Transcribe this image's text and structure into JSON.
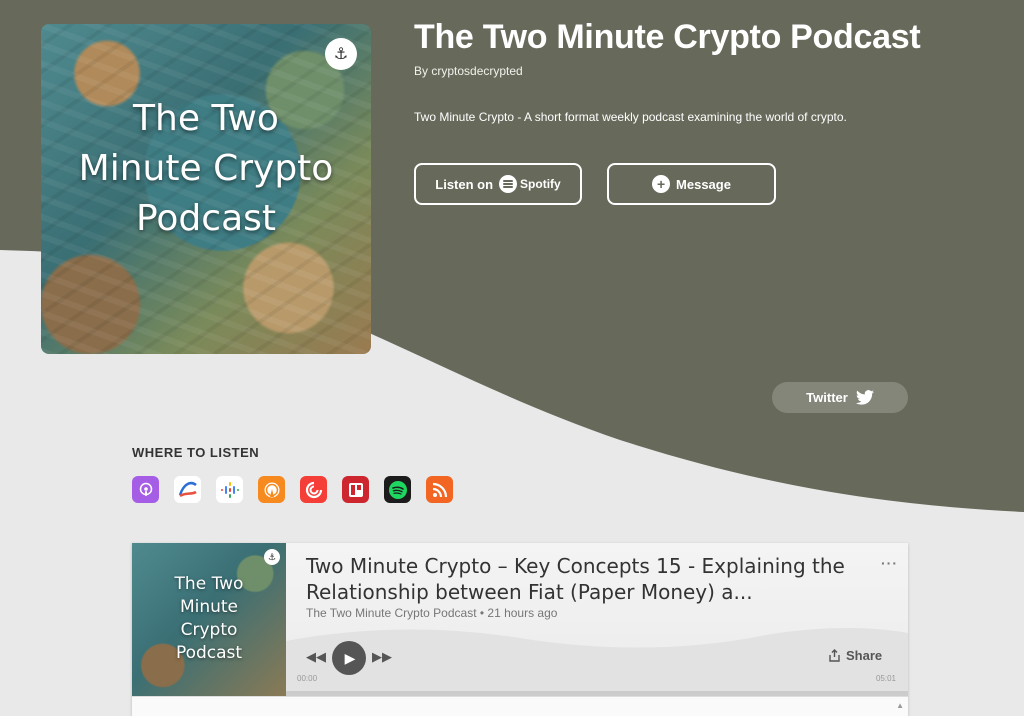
{
  "colors": {
    "hero": "#676a5b",
    "page": "#e9e9e9",
    "twitter_button": "#84867a"
  },
  "cover": {
    "title": "The Two Minute Crypto Podcast",
    "badge_icon": "anchor-logo-icon"
  },
  "podcast": {
    "title": "The Two Minute Crypto Podcast",
    "byline": "By cryptosdecrypted",
    "description": "Two Minute Crypto - A short format weekly podcast examining the world of crypto."
  },
  "buttons": {
    "listen_on": "Listen on",
    "spotify": "Spotify",
    "message": "Message",
    "twitter": "Twitter"
  },
  "where_to_listen": {
    "label": "WHERE TO LISTEN",
    "platforms": [
      {
        "name": "Apple Podcasts",
        "icon": "apple-podcasts-icon",
        "color": "#a65de6"
      },
      {
        "name": "Breaker",
        "icon": "breaker-icon",
        "color": "#ffffff"
      },
      {
        "name": "Google Podcasts",
        "icon": "google-podcasts-icon",
        "color": "#ffffff"
      },
      {
        "name": "Overcast",
        "icon": "overcast-icon",
        "color": "#f68a1f"
      },
      {
        "name": "Pocket Casts",
        "icon": "pocket-casts-icon",
        "color": "#f43e37"
      },
      {
        "name": "RadioPublic",
        "icon": "radiopublic-icon",
        "color": "#ce262f"
      },
      {
        "name": "Spotify",
        "icon": "spotify-icon",
        "color": "#1c1c1c"
      },
      {
        "name": "RSS",
        "icon": "rss-icon",
        "color": "#f26522"
      }
    ]
  },
  "player": {
    "art_title": "The Two Minute Crypto Podcast",
    "episode_title": "Two Minute Crypto – Key Concepts 15 - Explaining the Relationship between Fiat (Paper Money) a...",
    "meta": "The Two Minute Crypto Podcast • 21 hours ago",
    "more": "···",
    "share": "Share",
    "time_start": "00:00",
    "time_end": "05:01",
    "progress": 0
  }
}
